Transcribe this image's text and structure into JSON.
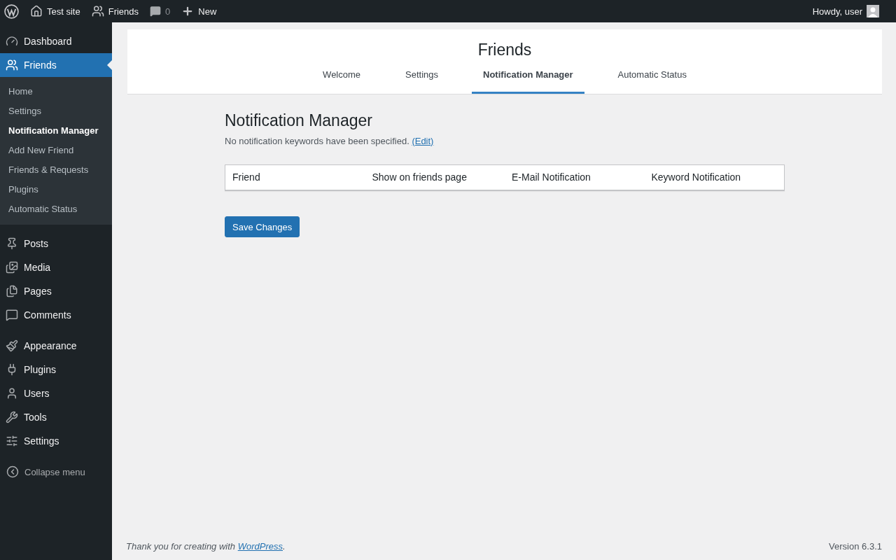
{
  "admin_bar": {
    "site": "Test site",
    "friends": "Friends",
    "comments_count": "0",
    "new": "New",
    "greeting": "Howdy, user"
  },
  "sidebar": {
    "groups": [
      {
        "items": [
          {
            "label": "Dashboard",
            "selected": false
          },
          {
            "label": "Friends",
            "selected": true,
            "submenu": [
              {
                "label": "Home",
                "selected": false
              },
              {
                "label": "Settings",
                "selected": false
              },
              {
                "label": "Notification Manager",
                "selected": true
              },
              {
                "label": "Add New Friend",
                "selected": false
              },
              {
                "label": "Friends & Requests",
                "selected": false
              },
              {
                "label": "Plugins",
                "selected": false
              },
              {
                "label": "Automatic Status",
                "selected": false
              }
            ]
          }
        ]
      },
      {
        "items": [
          {
            "label": "Posts",
            "selected": false
          },
          {
            "label": "Media",
            "selected": false
          },
          {
            "label": "Pages",
            "selected": false
          },
          {
            "label": "Comments",
            "selected": false
          }
        ]
      },
      {
        "items": [
          {
            "label": "Appearance",
            "selected": false
          },
          {
            "label": "Plugins",
            "selected": false
          },
          {
            "label": "Users",
            "selected": false
          },
          {
            "label": "Tools",
            "selected": false
          },
          {
            "label": "Settings",
            "selected": false
          }
        ]
      }
    ],
    "collapse": "Collapse menu"
  },
  "header": {
    "title": "Friends",
    "tabs": [
      {
        "label": "Welcome",
        "selected": false
      },
      {
        "label": "Settings",
        "selected": false
      },
      {
        "label": "Notification Manager",
        "selected": true
      },
      {
        "label": "Automatic Status",
        "selected": false
      }
    ]
  },
  "main": {
    "heading": "Notification Manager",
    "notice": "No notification keywords have been specified.",
    "notice_link": "(Edit)",
    "table": {
      "columns": [
        "Friend",
        "Show on friends page",
        "E-Mail Notification",
        "Keyword Notification"
      ]
    },
    "save_button": "Save Changes"
  },
  "footer": {
    "thanks": "Thank you for creating with ",
    "link": "WordPress",
    "thanks_end": ".",
    "version": "Version 6.3.1"
  }
}
